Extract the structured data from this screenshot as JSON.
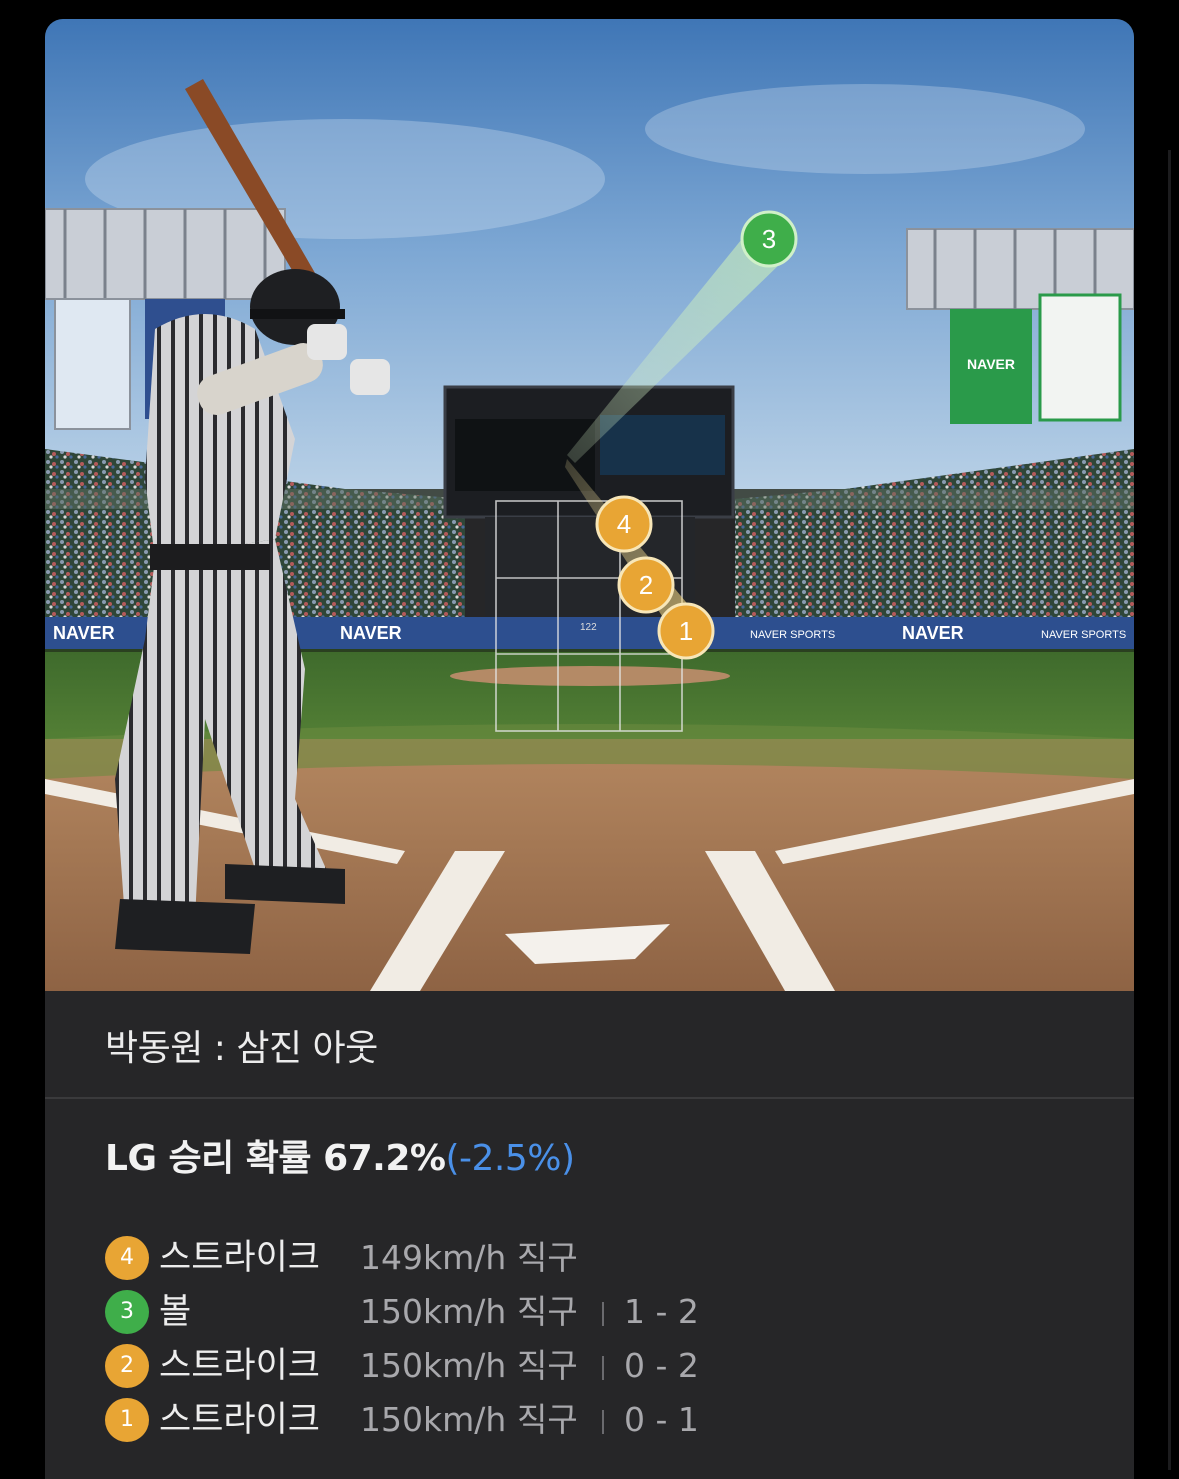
{
  "scene": {
    "banner_text": "NAVER",
    "banner_sports": "NAVER SPORTS",
    "scoreboard_speed": "122",
    "pitch_markers": [
      {
        "num": "1",
        "color": "#e8a534"
      },
      {
        "num": "2",
        "color": "#e8a534"
      },
      {
        "num": "3",
        "color": "#3fae4a"
      },
      {
        "num": "4",
        "color": "#e8a534"
      }
    ]
  },
  "result": {
    "text": "박동원 : 삼진 아웃"
  },
  "win_probability": {
    "label": "LG 승리 확률 67.2%",
    "delta": "(-2.5%)",
    "delta_color": "#4a90e8"
  },
  "pitches": [
    {
      "num": "4",
      "color": "#e8a534",
      "result": "스트라이크",
      "speed": "149km/h",
      "type": "직구",
      "count": ""
    },
    {
      "num": "3",
      "color": "#3fae4a",
      "result": "볼",
      "speed": "150km/h",
      "type": "직구",
      "count": "1 - 2"
    },
    {
      "num": "2",
      "color": "#e8a534",
      "result": "스트라이크",
      "speed": "150km/h",
      "type": "직구",
      "count": "0 - 2"
    },
    {
      "num": "1",
      "color": "#e8a534",
      "result": "스트라이크",
      "speed": "150km/h",
      "type": "직구",
      "count": "0 - 1"
    }
  ]
}
